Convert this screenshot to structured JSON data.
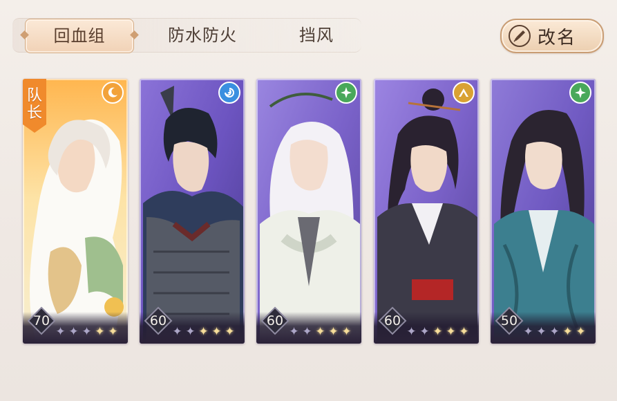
{
  "tabs": [
    {
      "label": "回血组",
      "active": true
    },
    {
      "label": "防水防火",
      "active": false
    },
    {
      "label": "挡风",
      "active": false
    }
  ],
  "rename_button": {
    "label": "改名",
    "icon": "brush-icon"
  },
  "captain_badge": "队长",
  "cards": [
    {
      "level": "70",
      "stars_lit": 2,
      "stars_total": 5,
      "element_icon": "moon-icon",
      "element_color": "#f2a23a",
      "theme": "gold"
    },
    {
      "level": "60",
      "stars_lit": 3,
      "stars_total": 5,
      "element_icon": "water-swirl-icon",
      "element_color": "#3a8fe0",
      "theme": "purple"
    },
    {
      "level": "60",
      "stars_lit": 3,
      "stars_total": 5,
      "element_icon": "wind-icon",
      "element_color": "#49a85a",
      "theme": "purple"
    },
    {
      "level": "60",
      "stars_lit": 3,
      "stars_total": 5,
      "element_icon": "mountain-icon",
      "element_color": "#d9a233",
      "theme": "purple"
    },
    {
      "level": "50",
      "stars_lit": 2,
      "stars_total": 5,
      "element_icon": "wind-icon",
      "element_color": "#49a85a",
      "theme": "purple"
    }
  ],
  "colors": {
    "accent": "#d4ab84",
    "card_purple": "#7b62c9",
    "card_gold": "#f2b55a"
  }
}
